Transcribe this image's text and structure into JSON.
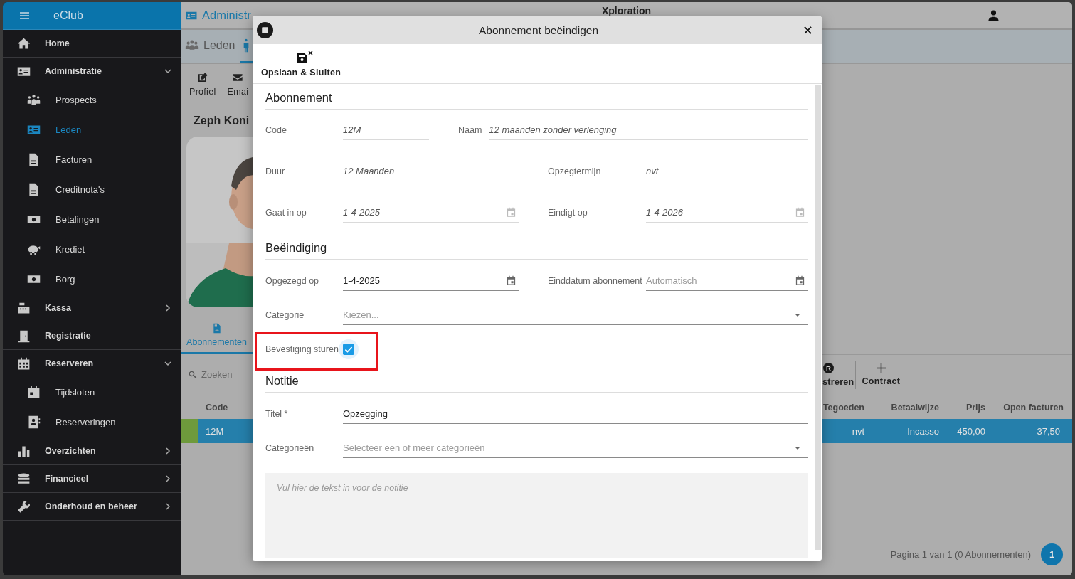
{
  "header": {
    "section": "Administr",
    "center_title": "Xploration"
  },
  "sidebar": {
    "app_title": "eClub",
    "items": [
      {
        "label": "Home",
        "selected": false
      },
      {
        "label": "Administratie",
        "selected": false,
        "expanded": true,
        "children": [
          {
            "label": "Prospects",
            "selected": false
          },
          {
            "label": "Leden",
            "selected": true
          },
          {
            "label": "Facturen",
            "selected": false
          },
          {
            "label": "Creditnota's",
            "selected": false
          },
          {
            "label": "Betalingen",
            "selected": false
          },
          {
            "label": "Krediet",
            "selected": false
          },
          {
            "label": "Borg",
            "selected": false
          }
        ]
      },
      {
        "label": "Kassa",
        "selected": false,
        "expanded": false
      },
      {
        "label": "Registratie",
        "selected": false
      },
      {
        "label": "Reserveren",
        "selected": false,
        "expanded": true,
        "children": [
          {
            "label": "Tijdsloten",
            "selected": false
          },
          {
            "label": "Reserveringen",
            "selected": false
          }
        ]
      },
      {
        "label": "Overzichten",
        "selected": false,
        "expanded": false
      },
      {
        "label": "Financieel",
        "selected": false,
        "expanded": false
      },
      {
        "label": "Onderhoud en beheer",
        "selected": false,
        "expanded": false
      }
    ]
  },
  "member_tabs": [
    {
      "label": "Leden",
      "selected": false
    },
    {
      "selected": true
    }
  ],
  "member_actions": [
    "Profiel",
    "Emai"
  ],
  "member_name": "Zeph Koni",
  "detail_tabs": [
    {
      "label": "Abonnementen",
      "selected": true
    }
  ],
  "search": {
    "placeholder": "Zoeken"
  },
  "subscription_actions": [
    {
      "label": "streren",
      "icon_letter": "R"
    },
    {
      "label": "Contract"
    }
  ],
  "table": {
    "columns": [
      "Code",
      "Tegoeden",
      "Betaalwijze",
      "Prijs",
      "Open facturen"
    ],
    "rows": [
      {
        "selected": true,
        "color": "#6e9a3c",
        "cells": [
          "12M",
          "nvt",
          "Incasso",
          "450,00",
          "37,50"
        ]
      }
    ]
  },
  "pagination": {
    "summary": "Pagina 1 van 1 (0 Abonnementen)",
    "pages": [
      {
        "label": "1",
        "selected": true
      }
    ]
  },
  "dialog": {
    "title": "Abonnement beëindigen",
    "actions": [
      {
        "label": "Opslaan & Sluiten"
      }
    ],
    "sections": [
      {
        "title": "Abonnement",
        "rows": [
          {
            "kind": "narrow",
            "fields": [
              {
                "kind": "text",
                "label": "Code",
                "value": "12M",
                "readonly": true
              },
              {
                "kind": "text",
                "label": "Naam",
                "value": "12 maanden zonder verlenging",
                "readonly": true
              }
            ]
          },
          {
            "kind": "pair",
            "fields": [
              {
                "kind": "text",
                "label": "Duur",
                "value": "12 Maanden",
                "readonly": true
              },
              {
                "kind": "text",
                "label": "Opzegtermijn",
                "value": "nvt",
                "readonly": true
              }
            ]
          },
          {
            "kind": "pair",
            "fields": [
              {
                "kind": "date",
                "label": "Gaat in op",
                "value": "1-4-2025",
                "readonly": true
              },
              {
                "kind": "date",
                "label": "Eindigt op",
                "value": "1-4-2026",
                "readonly": true
              }
            ]
          }
        ]
      },
      {
        "title": "Beëindiging",
        "rows": [
          {
            "kind": "pair",
            "fields": [
              {
                "kind": "date",
                "label": "Opgezegd op",
                "value": "1-4-2025",
                "readonly": false
              },
              {
                "kind": "date",
                "label": "Einddatum abonnement",
                "placeholder": "Automatisch",
                "readonly": false
              }
            ]
          },
          {
            "kind": "single",
            "fields": [
              {
                "kind": "select",
                "label": "Categorie",
                "placeholder": "Kiezen...",
                "readonly": false
              }
            ]
          },
          {
            "kind": "single",
            "fields": [
              {
                "kind": "checkbox",
                "label": "Bevestiging sturen",
                "checked": true,
                "highlighted": true
              }
            ]
          }
        ]
      },
      {
        "title": "Notitie",
        "rows": [
          {
            "kind": "single",
            "fields": [
              {
                "kind": "text",
                "label": "Titel *",
                "value": "Opzegging",
                "readonly": false
              }
            ]
          },
          {
            "kind": "single",
            "fields": [
              {
                "kind": "select",
                "label": "Categorieën",
                "placeholder": "Selecteer een of meer categorieën",
                "readonly": false
              }
            ]
          },
          {
            "kind": "single",
            "fields": [
              {
                "kind": "textarea",
                "placeholder": "Vul hier de tekst in voor de notitie"
              }
            ]
          }
        ]
      }
    ]
  }
}
